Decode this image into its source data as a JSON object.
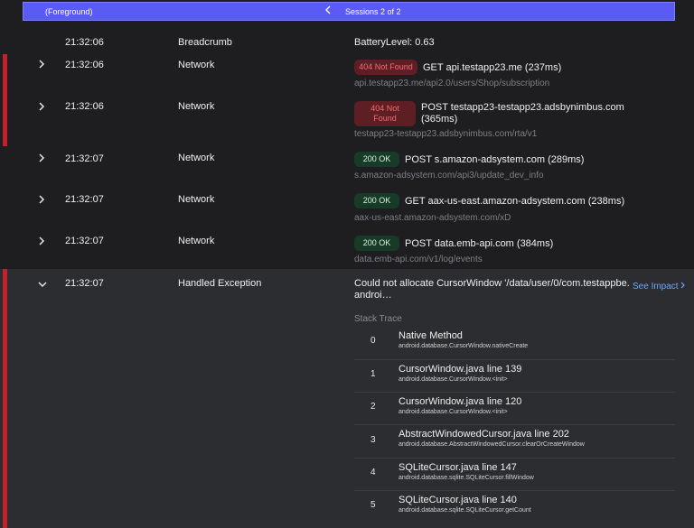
{
  "topbar": {
    "foreground_label": "(Foreground)",
    "sessions_label": "Sessions 2 of 2"
  },
  "rows": [
    {
      "time": "21:32:06",
      "category": "Breadcrumb",
      "description": "BatteryLevel: 0.63"
    },
    {
      "time": "21:32:06",
      "category": "Network",
      "status": "404 Not Found",
      "description": "GET api.testapp23.me (237ms)",
      "url": "api.testapp23.me/api2.0/users/Shop/subscription"
    },
    {
      "time": "21:32:06",
      "category": "Network",
      "status_line1": "404 Not",
      "status_line2": "Found",
      "description_line1": "POST testapp23-testapp23.adsbynimbus.com",
      "description_line2": "(365ms)",
      "url": "testapp23-testapp23.adsbynimbus.com/rta/v1"
    },
    {
      "time": "21:32:07",
      "category": "Network",
      "status": "200 OK",
      "description": "POST s.amazon-adsystem.com (289ms)",
      "url": "s.amazon-adsystem.com/api3/update_dev_info"
    },
    {
      "time": "21:32:07",
      "category": "Network",
      "status": "200 OK",
      "description": "GET aax-us-east.amazon-adsystem.com (238ms)",
      "url": "aax-us-east.amazon-adsystem.com/xD"
    },
    {
      "time": "21:32:07",
      "category": "Network",
      "status": "200 OK",
      "description": "POST data.emb-api.com (384ms)",
      "url": "data.emb-api.com/v1/log/events"
    },
    {
      "time": "21:32:07",
      "category": "Handled Exception",
      "description_line1": "Could not allocate CursorWindow '/data/user/0/com.testappbe.",
      "description_line2": "androi…"
    }
  ],
  "exception": {
    "see_impact": "See Impact",
    "stack_title": "Stack Trace",
    "frames": [
      {
        "index": "0",
        "method": "Native Method",
        "class": "android.database.CursorWindow.nativeCreate"
      },
      {
        "index": "1",
        "method": "CursorWindow.java line 139",
        "class": "android.database.CursorWindow.<init>"
      },
      {
        "index": "2",
        "method": "CursorWindow.java line 120",
        "class": "android.database.CursorWindow.<init>"
      },
      {
        "index": "3",
        "method": "AbstractWindowedCursor.java line 202",
        "class": "android.database.AbstractWindowedCursor.clearOrCreateWindow"
      },
      {
        "index": "4",
        "method": "SQLiteCursor.java line 147",
        "class": "android.database.sqlite.SQLiteCursor.fillWindow"
      },
      {
        "index": "5",
        "method": "SQLiteCursor.java line 140",
        "class": "android.database.sqlite.SQLiteCursor.getCount"
      }
    ]
  },
  "icons": {
    "chevron_left": "chevron-left-icon",
    "chevron_right": "chevron-right-icon",
    "chevron_down": "chevron-down-icon"
  },
  "colors": {
    "accent": "#5a5bf5",
    "error_bar": "#c2202b",
    "error_badge_bg": "#5d1f24",
    "error_badge_text": "#f46a73",
    "ok_badge_bg": "#173b27",
    "link": "#6ea8ff"
  }
}
